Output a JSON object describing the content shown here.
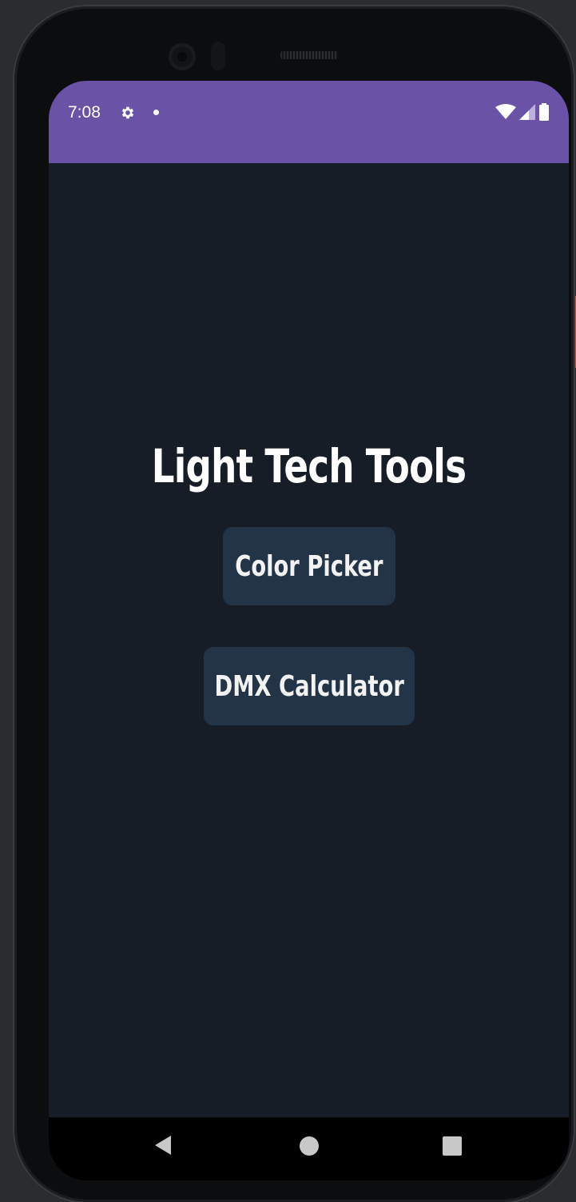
{
  "status_bar": {
    "time": "7:08",
    "background_color": "#6a52a6",
    "icons": [
      "settings-icon",
      "notification-dot-icon",
      "wifi-icon",
      "cell-signal-icon",
      "battery-icon"
    ]
  },
  "app": {
    "title": "Light Tech Tools",
    "background_color": "#171d26",
    "buttons": [
      {
        "label": "Color Picker",
        "color": "#243447"
      },
      {
        "label": "DMX Calculator",
        "color": "#243447"
      }
    ]
  },
  "nav_bar": {
    "icons": [
      "back-icon",
      "home-icon",
      "recents-icon"
    ]
  }
}
